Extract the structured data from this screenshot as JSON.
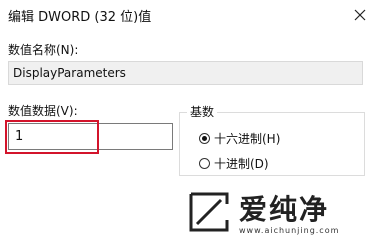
{
  "dialog": {
    "title": "编辑 DWORD (32 位)值",
    "close_icon": "close-icon"
  },
  "name": {
    "label": "数值名称(N):",
    "value": "DisplayParameters"
  },
  "data": {
    "label": "数值数据(V):",
    "value": "1"
  },
  "base": {
    "legend": "基数",
    "options": [
      {
        "label": "十六进制(H)",
        "selected": true
      },
      {
        "label": "十进制(D)",
        "selected": false
      }
    ]
  },
  "watermark": {
    "brand": "爱纯净",
    "url": "www.aichunjing.com",
    "logo_icon": "slash-logo-icon"
  },
  "colors": {
    "highlight": "#d3142b",
    "readonly_field": "#f0f0f0"
  }
}
